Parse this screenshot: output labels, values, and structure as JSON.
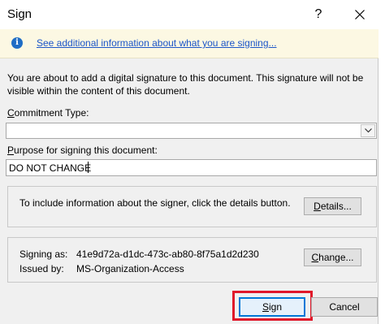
{
  "window": {
    "title": "Sign",
    "help_label": "?"
  },
  "infobar": {
    "link_text": "See additional information about what you are signing..."
  },
  "intro_text": "You are about to add a digital signature to this document. This signature will not be visible within the content of this document.",
  "commitment": {
    "label_first": "C",
    "label_rest": "ommitment Type:",
    "value": ""
  },
  "purpose": {
    "label_first": "P",
    "label_rest": "urpose for signing this document:",
    "value": "DO NOT CHANGE"
  },
  "details_group": {
    "text": "To include information about the signer, click the details button.",
    "button_first": "D",
    "button_rest": "etails..."
  },
  "signer_group": {
    "signing_as_label": "Signing as:",
    "signing_as_value": "41e9d72a-d1dc-473c-ab80-8f75a1d2d230",
    "issued_by_label": "Issued by:",
    "issued_by_value": "MS-Organization-Access",
    "change_button_first": "C",
    "change_button_rest": "hange..."
  },
  "buttons": {
    "sign_first": "S",
    "sign_rest": "ign",
    "cancel": "Cancel"
  },
  "colors": {
    "highlight": "#e0182a",
    "link": "#1b55c8",
    "info_icon": "#1f6dc5",
    "infobar_bg": "#fcf8e3",
    "default_button_border": "#0078d7"
  },
  "icons": {
    "info": "info-icon",
    "close": "close-icon",
    "dropdown": "chevron-down-icon"
  }
}
